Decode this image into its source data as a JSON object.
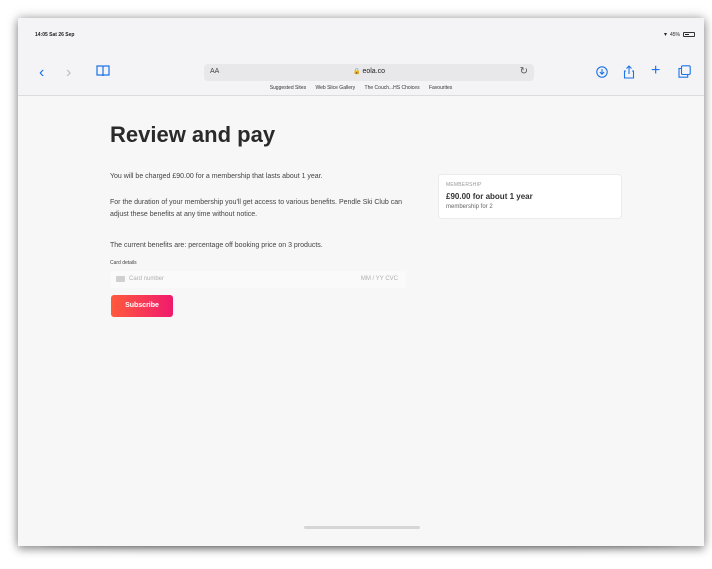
{
  "status_bar": {
    "time": "14:05  Sat 26 Sep",
    "wifi": "▾",
    "battery": "45%"
  },
  "toolbar": {
    "back_icon": "chevron-left-icon",
    "forward_icon": "chevron-right-icon",
    "bookmarks_icon": "book-icon",
    "text_size_label": "AA",
    "url": "eola.co",
    "reload_icon": "reload-icon",
    "download_icon": "download-icon",
    "share_icon": "share-icon",
    "plus_icon": "plus-icon",
    "tabs_icon": "tabs-icon"
  },
  "favourites": [
    "Suggested Sites",
    "Web Slice Gallery",
    "The Couch...HS Choices",
    "Favourites"
  ],
  "page": {
    "title": "Review and pay",
    "charge_text": "You will be charged £90.00 for a membership that lasts about 1 year.",
    "benefits_text": "For the duration of your membership you'll get access to various benefits. Pendle Ski Club can adjust these benefits at any time without notice.",
    "current_benefits_text": "The current benefits are: percentage off booking price on 3 products.",
    "card_details_label": "Card details",
    "card_number_placeholder": "Card number",
    "card_extra_placeholder": "MM / YY  CVC",
    "subscribe_label": "Subscribe",
    "accent_color": "#f01a6d"
  },
  "membership": {
    "label": "MEMBERSHIP",
    "price": "£90.00 for about 1 year",
    "subtitle": "membership for 2"
  }
}
